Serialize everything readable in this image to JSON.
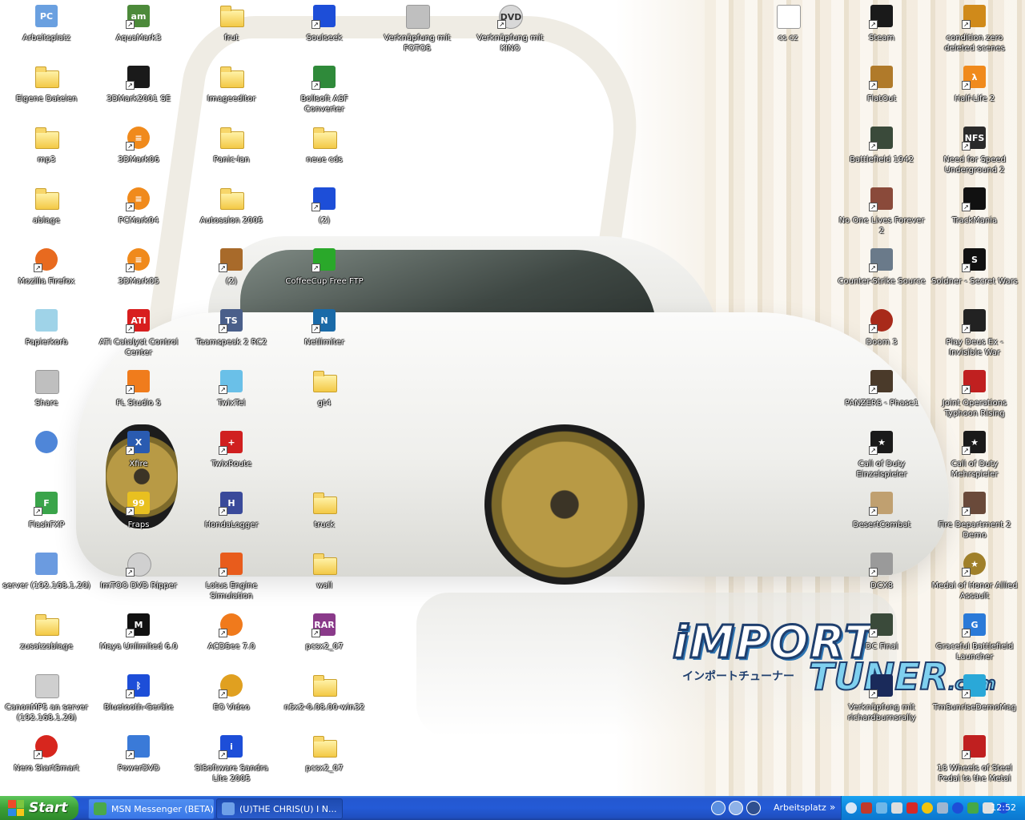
{
  "desktop": {
    "wallpaper": {
      "logo_line1": "iMPORT",
      "logo_line2": "TUNER",
      "logo_dot": ".com",
      "logo_jp": "インポートチューナー"
    },
    "icons": [
      {
        "label": "Arbeitsplatz",
        "icon": "computer-icon"
      },
      {
        "label": "Eigene Dateien",
        "icon": "documents-folder-icon"
      },
      {
        "label": "mp3",
        "icon": "folder-icon"
      },
      {
        "label": "ablage",
        "icon": "folder-icon"
      },
      {
        "label": "Mozilla Firefox",
        "icon": "firefox-icon"
      },
      {
        "label": "Papierkorb",
        "icon": "recycle-bin-icon"
      },
      {
        "label": "Share",
        "icon": "share-icon"
      },
      {
        "label": "",
        "icon": "network-icon"
      },
      {
        "label": "FlashFXP",
        "icon": "flashfxp-icon"
      },
      {
        "label": "server (192.168.1.20)",
        "icon": "server-icon"
      },
      {
        "label": "zusatzablage",
        "icon": "folder-icon"
      },
      {
        "label": "CanonMP5 an server (192.168.1.20)",
        "icon": "printer-icon"
      },
      {
        "label": "Nero StartSmart",
        "icon": "nero-icon"
      },
      {
        "label": "AquaMark3",
        "icon": "aquamark-icon"
      },
      {
        "label": "3DMark2001 SE",
        "icon": "3dmark-icon"
      },
      {
        "label": "3DMark06",
        "icon": "futuremark-icon"
      },
      {
        "label": "PCMark04",
        "icon": "futuremark-icon"
      },
      {
        "label": "3DMark05",
        "icon": "futuremark-icon"
      },
      {
        "label": "ATI Catalyst Control Center",
        "icon": "ati-icon"
      },
      {
        "label": "FL Studio 5",
        "icon": "fl-studio-icon"
      },
      {
        "label": "Xfire",
        "icon": "xfire-icon"
      },
      {
        "label": "Fraps",
        "icon": "fraps-icon"
      },
      {
        "label": "ImTOO DVD Ripper",
        "icon": "dvd-ripper-icon"
      },
      {
        "label": "Maya Unlimited 6.0",
        "icon": "maya-icon"
      },
      {
        "label": "Bluetooth-Geräte",
        "icon": "bluetooth-icon"
      },
      {
        "label": "PowerDVD",
        "icon": "powerdvd-icon"
      },
      {
        "label": "frut",
        "icon": "folder-icon"
      },
      {
        "label": "Imageeditor",
        "icon": "folder-icon"
      },
      {
        "label": "Panic-lan",
        "icon": "folder-icon"
      },
      {
        "label": "Autosalon 2005",
        "icon": "folder-icon"
      },
      {
        "label": "(2)",
        "icon": "emule-icon"
      },
      {
        "label": "Teamspeak 2 RC2",
        "icon": "teamspeak-icon"
      },
      {
        "label": "TwixTel",
        "icon": "twixtel-icon"
      },
      {
        "label": "TwixRoute",
        "icon": "twixroute-icon"
      },
      {
        "label": "HondaLogger",
        "icon": "hondalogger-icon"
      },
      {
        "label": "Lotus Engine Simulation",
        "icon": "lotus-icon"
      },
      {
        "label": "ACDSee 7.0",
        "icon": "acdsee-icon"
      },
      {
        "label": "EO Video",
        "icon": "eo-video-icon"
      },
      {
        "label": "SiSoftware Sandra Lite 2005",
        "icon": "sandra-icon"
      },
      {
        "label": "Soulseek",
        "icon": "soulseek-icon"
      },
      {
        "label": "Bollsoft ASF Converter",
        "icon": "asf-converter-icon"
      },
      {
        "label": "neue cds",
        "icon": "folder-icon"
      },
      {
        "label": "(2)",
        "icon": "app-icon"
      },
      {
        "label": "CoffeeCup Free FTP",
        "icon": "coffeecup-icon"
      },
      {
        "label": "Netlimiter",
        "icon": "netlimiter-icon"
      },
      {
        "label": "gt4",
        "icon": "folder-icon"
      },
      {
        "label": "truck",
        "icon": "folder-icon"
      },
      {
        "label": "wall",
        "icon": "folder-icon"
      },
      {
        "label": "pcsx2_07",
        "icon": "winrar-icon"
      },
      {
        "label": "n5x2-0.08.00-win32",
        "icon": "folder-icon"
      },
      {
        "label": "pcsx2_07",
        "icon": "folder-icon"
      },
      {
        "label": "Verknüpfung mit FOTOS",
        "icon": "camera-icon"
      },
      {
        "label": "Verknüpfung mit KINO",
        "icon": "dvd-icon"
      },
      {
        "label": "cs cz",
        "icon": "text-file-icon"
      },
      {
        "label": "Steam",
        "icon": "steam-icon"
      },
      {
        "label": "FlatOut",
        "icon": "flatout-icon"
      },
      {
        "label": "Battlefield 1942",
        "icon": "battlefield-icon"
      },
      {
        "label": "No One Lives Forever 2",
        "icon": "nolf2-icon"
      },
      {
        "label": "Counter-Strike Source",
        "icon": "cs-source-icon"
      },
      {
        "label": "Doom 3",
        "icon": "doom3-icon"
      },
      {
        "label": "PANZERS - Phase1",
        "icon": "panzers-icon"
      },
      {
        "label": "Call of Duty Einzelspieler",
        "icon": "cod-icon"
      },
      {
        "label": "DesertCombat",
        "icon": "desertcombat-icon"
      },
      {
        "label": "DCX8",
        "icon": "dcx8-icon"
      },
      {
        "label": "DC Final",
        "icon": "battlefield-icon"
      },
      {
        "label": "Verknüpfung mit richardburnsrally",
        "icon": "rally-icon"
      },
      {
        "label": "condition zero deleted scenes",
        "icon": "cz-icon"
      },
      {
        "label": "Half-Life 2",
        "icon": "half-life-2-icon"
      },
      {
        "label": "Need for Speed Underground 2",
        "icon": "nfs-icon"
      },
      {
        "label": "TrackMania",
        "icon": "trackmania-icon"
      },
      {
        "label": "Soldner - Secret Wars",
        "icon": "soldner-icon"
      },
      {
        "label": "Play Deus Ex - Invisible War",
        "icon": "deus-ex-icon"
      },
      {
        "label": "Joint Operations Typhoon Rising",
        "icon": "joint-ops-icon"
      },
      {
        "label": "Call of Duty Mehrspieler",
        "icon": "cod-icon"
      },
      {
        "label": "Fire Department 2 Demo",
        "icon": "fire-dept-icon"
      },
      {
        "label": "Medal of Honor Allied Assault",
        "icon": "moh-icon"
      },
      {
        "label": "Graceful Battlefield Launcher",
        "icon": "gbl-icon"
      },
      {
        "label": "TmSunriseDemoMag",
        "icon": "tmsunrise-icon"
      },
      {
        "label": "18 Wheels of Steel Pedal to the Metal",
        "icon": "truck-icon"
      }
    ]
  },
  "taskbar": {
    "start_label": "Start",
    "tasks": [
      {
        "label": "MSN Messenger (BETA)",
        "state": "inactive",
        "icon": "msn-icon"
      },
      {
        "label": "(U)THE CHRIS(U) I N...",
        "state": "active",
        "icon": "chat-icon"
      }
    ],
    "address_label": "Arbeitsplatz",
    "chevron": "»",
    "clock": "12:52",
    "tray_icons": [
      "back-icon",
      "shield-icon",
      "network-icon",
      "printer-icon",
      "ati-icon",
      "volume-icon",
      "monitor-icon",
      "bluetooth-icon",
      "messenger-icon",
      "safety-icon",
      "bluetooth-icon"
    ]
  },
  "colors": {
    "taskbar": "#245ad6",
    "start": "#3b9f36",
    "tray": "#0f87de"
  }
}
